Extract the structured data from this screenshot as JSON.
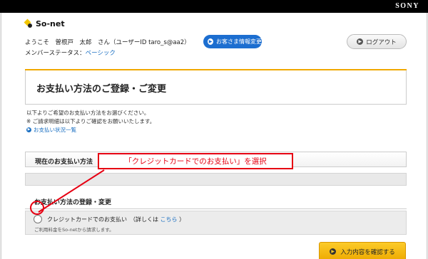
{
  "brand": {
    "sony": "SONY",
    "logo": "So-net"
  },
  "header": {
    "welcome": "ようこそ　曽根戸　太郎　さん（ユーザーID  taro_s@aa2）",
    "status_prefix": "メンバーステータス：",
    "status_value": "ベーシック",
    "info_button": "お客さま情報変更",
    "logout_button": "ログアウト"
  },
  "title": "お支払い方法のご登録・ご変更",
  "intro": {
    "line1": "以下よりご希望のお支払い方法をお選びください。",
    "line2": "※ ご請求明細は以下よりご確認をお願いいたします。",
    "link": "お支払い状況一覧"
  },
  "section_current": {
    "title": "現在のお支払い方法"
  },
  "section_register": {
    "title": "お支払い方法の登録・変更",
    "option_label": "クレジットカードでのお支払い　（詳しくは",
    "option_link": "こちら",
    "option_close": "）",
    "option_note": "ご利用料金をSo-netから請求します。"
  },
  "confirm_button": "入力内容を確認する",
  "annotation": "「クレジットカードでのお支払い」を選択",
  "colors": {
    "accent_gold": "#f0a800",
    "annotation_red": "#e60012",
    "link_blue": "#1a6fc2"
  }
}
